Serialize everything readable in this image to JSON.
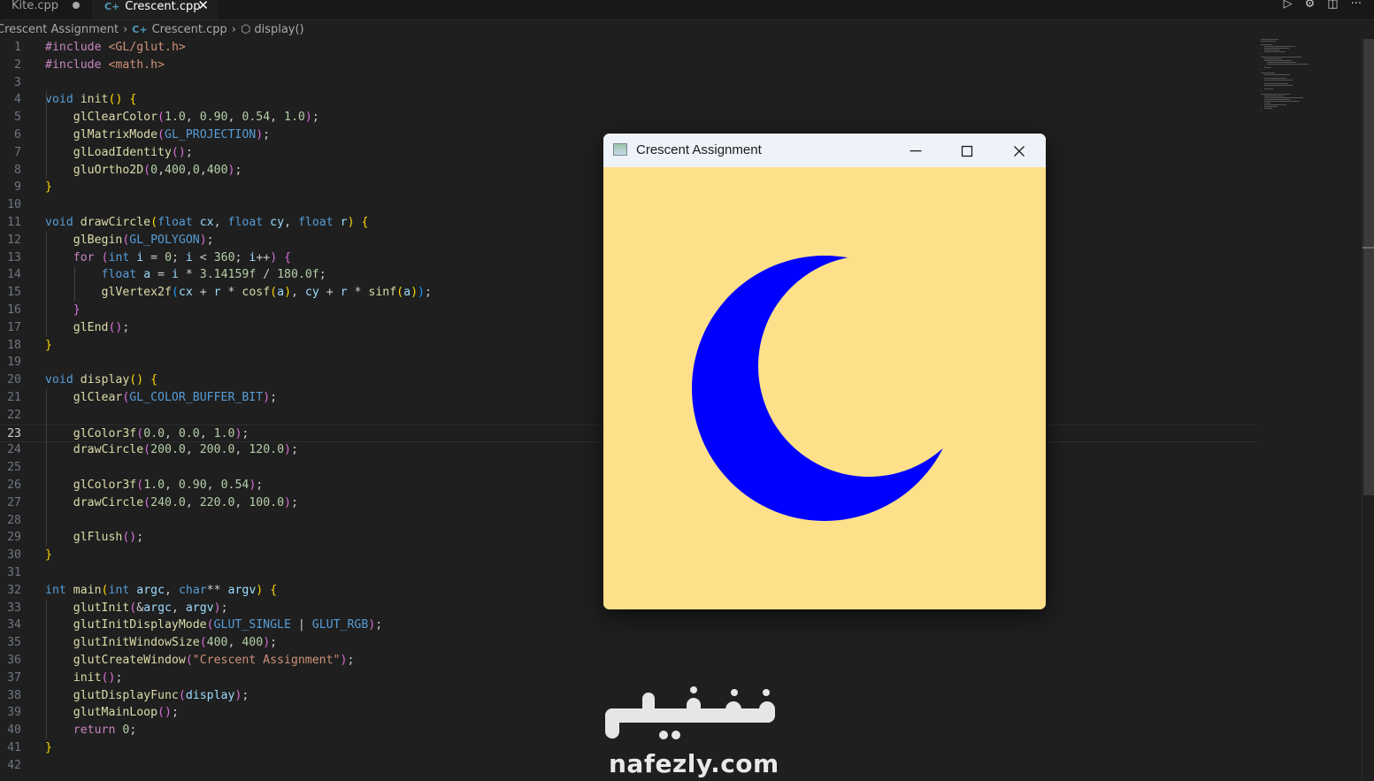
{
  "tabs": [
    {
      "label": "Kite.cpp",
      "modified": true,
      "active": false
    },
    {
      "label": "Crescent.cpp",
      "active": true
    }
  ],
  "breadcrumb": [
    "Crescent Assignment",
    "Crescent.cpp",
    "display()"
  ],
  "current_line": 23,
  "code_lines": [
    "#include <GL/glut.h>",
    "#include <math.h>",
    "",
    "void init() {",
    "    glClearColor(1.0, 0.90, 0.54, 1.0);",
    "    glMatrixMode(GL_PROJECTION);",
    "    glLoadIdentity();",
    "    gluOrtho2D(0,400,0,400);",
    "}",
    "",
    "void drawCircle(float cx, float cy, float r) {",
    "    glBegin(GL_POLYGON);",
    "    for (int i = 0; i < 360; i++) {",
    "        float a = i * 3.14159f / 180.0f;",
    "        glVertex2f(cx + r * cosf(a), cy + r * sinf(a));",
    "    }",
    "    glEnd();",
    "}",
    "",
    "void display() {",
    "    glClear(GL_COLOR_BUFFER_BIT);",
    "",
    "    glColor3f(0.0, 0.0, 1.0);",
    "    drawCircle(200.0, 200.0, 120.0);",
    "",
    "    glColor3f(1.0, 0.90, 0.54);",
    "    drawCircle(240.0, 220.0, 100.0);",
    "",
    "    glFlush();",
    "}",
    "",
    "int main(int argc, char** argv) {",
    "    glutInit(&argc, argv);",
    "    glutInitDisplayMode(GLUT_SINGLE | GLUT_RGB);",
    "    glutInitWindowSize(400, 400);",
    "    glutCreateWindow(\"Crescent Assignment\");",
    "    init();",
    "    glutDisplayFunc(display);",
    "    glutMainLoop();",
    "    return 0;",
    "}",
    ""
  ],
  "glut_window": {
    "title": "Crescent Assignment",
    "background_color": "#fee08a",
    "shape_color": "#0000ff",
    "buttons": {
      "minimize": "minimize-icon",
      "maximize": "maximize-icon",
      "close": "close-icon"
    }
  },
  "watermark": {
    "logo_text": "نفذلي",
    "url": "nafezly.com"
  },
  "colors": {
    "editor_bg": "#1f1f1f",
    "tabbar_bg": "#181818",
    "keyword": "#569cd6",
    "function": "#dcdcaa",
    "number": "#b5cea8",
    "string": "#ce9178"
  }
}
